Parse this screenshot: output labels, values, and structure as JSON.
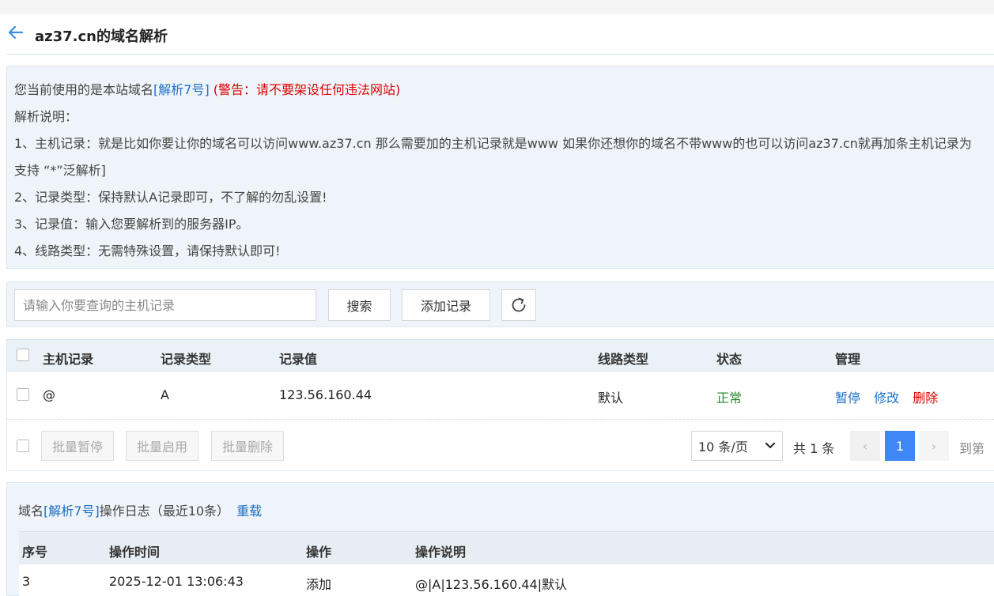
{
  "header": {
    "title": "az37.cn的域名解析"
  },
  "notice": {
    "line1_prefix": "您当前使用的是本站域名",
    "line1_domain": "[解析7号]",
    "line1_warning": "(警告：请不要架设任何违法网站)",
    "line2": "解析说明：",
    "line3": "1、主机记录：就是比如你要让你的域名可以访问www.az37.cn 那么需要加的主机记录就是www 如果你还想你的域名不带www的也可以访问az37.cn就再加条主机记录为",
    "line4": "支持 “*”泛解析]",
    "line5": "2、记录类型：保持默认A记录即可，不了解的勿乱设置!",
    "line6": "3、记录值：输入您要解析到的服务器IP。",
    "line7": "4、线路类型：无需特殊设置，请保持默认即可!"
  },
  "toolbar": {
    "search_placeholder": "请输入你要查询的主机记录",
    "search_value": "",
    "search_label": "搜索",
    "add_label": "添加记录"
  },
  "dns_table": {
    "columns": [
      "主机记录",
      "记录类型",
      "记录值",
      "线路类型",
      "状态",
      "管理"
    ],
    "rows": [
      {
        "host": "@",
        "type": "A",
        "value": "123.56.160.44",
        "line": "默认",
        "status": "正常",
        "actions": {
          "pause": "暂停",
          "edit": "修改",
          "delete": "删除"
        }
      }
    ]
  },
  "bulk": {
    "pause_label": "批量暂停",
    "enable_label": "批量启用",
    "delete_label": "批量删除"
  },
  "pagination": {
    "page_size": "10 条/页",
    "total": "共 1 条",
    "current_page": "1",
    "prev": "‹",
    "next": "›",
    "goto_label": "到第"
  },
  "log": {
    "title_prefix": "域名",
    "title_domain": "[解析7号]",
    "title_suffix": "操作日志（最近10条）",
    "reload_label": "重载",
    "columns": [
      "序号",
      "操作时间",
      "操作",
      "操作说明"
    ],
    "rows": [
      {
        "no": "3",
        "time": "2025-12-01 13:06:43",
        "op": "添加",
        "desc": "@|A|123.56.160.44|默认"
      }
    ]
  },
  "colors": {
    "accent_blue": "#1e6fc7",
    "warning_red": "#e00000",
    "status_green": "#2e8b2e",
    "page_active": "#3f87f5",
    "panel_bg": "#eef4f9"
  }
}
